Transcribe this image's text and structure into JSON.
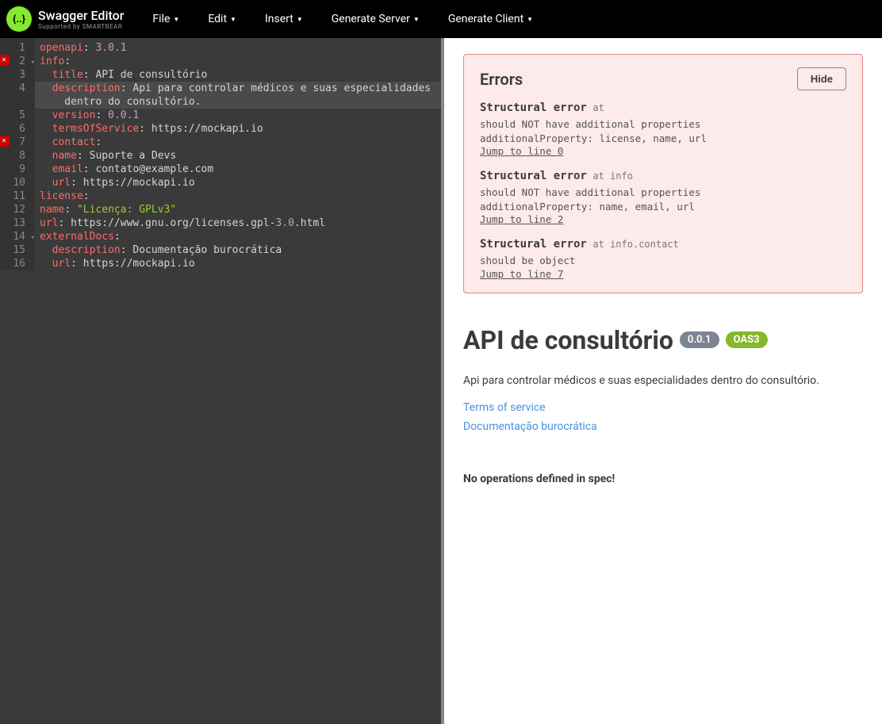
{
  "topbar": {
    "logo_main": "Swagger Editor",
    "logo_sub": "Supported by SMARTBEAR",
    "menu": [
      "File",
      "Edit",
      "Insert",
      "Generate Server",
      "Generate Client"
    ]
  },
  "editor": {
    "lines": [
      {
        "n": 1,
        "err": false,
        "fold": false,
        "hl": false,
        "tokens": [
          [
            "openapi",
            "key"
          ],
          [
            ": ",
            "punc"
          ],
          [
            "3.0.1",
            "num"
          ]
        ]
      },
      {
        "n": 2,
        "err": true,
        "fold": true,
        "hl": false,
        "tokens": [
          [
            "info",
            "key"
          ],
          [
            ":",
            "punc"
          ]
        ]
      },
      {
        "n": 3,
        "err": false,
        "fold": false,
        "hl": false,
        "tokens": [
          [
            "  ",
            ""
          ],
          [
            "title",
            "key"
          ],
          [
            ": ",
            "punc"
          ],
          [
            "API de consultório",
            "str"
          ]
        ]
      },
      {
        "n": 4,
        "err": false,
        "fold": false,
        "hl": true,
        "tokens": [
          [
            "  ",
            ""
          ],
          [
            "description",
            "key"
          ],
          [
            ": ",
            "punc"
          ],
          [
            "Api para controlar médicos e suas especialidades",
            "str"
          ]
        ]
      },
      {
        "n": "",
        "err": false,
        "fold": false,
        "hl": true,
        "tokens": [
          [
            "    dentro do consultório.",
            "str"
          ]
        ]
      },
      {
        "n": 5,
        "err": false,
        "fold": false,
        "hl": false,
        "tokens": [
          [
            "  ",
            ""
          ],
          [
            "version",
            "key"
          ],
          [
            ": ",
            "punc"
          ],
          [
            "0.0.1",
            "num"
          ]
        ]
      },
      {
        "n": 6,
        "err": false,
        "fold": false,
        "hl": false,
        "tokens": [
          [
            "  ",
            ""
          ],
          [
            "termsOfService",
            "key"
          ],
          [
            ": ",
            "punc"
          ],
          [
            "https://mockapi.io",
            "link"
          ]
        ]
      },
      {
        "n": 7,
        "err": true,
        "fold": false,
        "hl": false,
        "tokens": [
          [
            "  ",
            ""
          ],
          [
            "contact",
            "key"
          ],
          [
            ":",
            "punc"
          ]
        ]
      },
      {
        "n": 8,
        "err": false,
        "fold": false,
        "hl": false,
        "tokens": [
          [
            "  ",
            ""
          ],
          [
            "name",
            "key"
          ],
          [
            ": ",
            "punc"
          ],
          [
            "Suporte a Devs",
            "str"
          ]
        ]
      },
      {
        "n": 9,
        "err": false,
        "fold": false,
        "hl": false,
        "tokens": [
          [
            "  ",
            ""
          ],
          [
            "email",
            "key"
          ],
          [
            ": ",
            "punc"
          ],
          [
            "contato@example.com",
            "str"
          ]
        ]
      },
      {
        "n": 10,
        "err": false,
        "fold": false,
        "hl": false,
        "tokens": [
          [
            "  ",
            ""
          ],
          [
            "url",
            "key"
          ],
          [
            ": ",
            "punc"
          ],
          [
            "https://mockapi.io",
            "link"
          ]
        ]
      },
      {
        "n": 11,
        "err": false,
        "fold": false,
        "hl": false,
        "tokens": [
          [
            "license",
            "key"
          ],
          [
            ":",
            "punc"
          ]
        ]
      },
      {
        "n": 12,
        "err": false,
        "fold": false,
        "hl": false,
        "tokens": [
          [
            "name",
            "key"
          ],
          [
            ": ",
            "punc"
          ],
          [
            "\"Licença: GPLv3\"",
            "quoted"
          ]
        ]
      },
      {
        "n": 13,
        "err": false,
        "fold": false,
        "hl": false,
        "tokens": [
          [
            "url",
            "key"
          ],
          [
            ": ",
            "punc"
          ],
          [
            "https://www.gnu.org/licenses.gpl",
            "link"
          ],
          [
            "-",
            "punc"
          ],
          [
            "3.0",
            "num"
          ],
          [
            ".html",
            "link"
          ]
        ]
      },
      {
        "n": 14,
        "err": false,
        "fold": true,
        "hl": false,
        "tokens": [
          [
            "externalDocs",
            "key"
          ],
          [
            ":",
            "punc"
          ]
        ]
      },
      {
        "n": 15,
        "err": false,
        "fold": false,
        "hl": false,
        "tokens": [
          [
            "  ",
            ""
          ],
          [
            "description",
            "key"
          ],
          [
            ": ",
            "punc"
          ],
          [
            "Documentação burocrática",
            "str"
          ]
        ]
      },
      {
        "n": 16,
        "err": false,
        "fold": false,
        "hl": false,
        "tokens": [
          [
            "  ",
            ""
          ],
          [
            "url",
            "key"
          ],
          [
            ": ",
            "punc"
          ],
          [
            "https://mockapi.io",
            "link"
          ]
        ]
      }
    ]
  },
  "errors": {
    "title": "Errors",
    "hide": "Hide",
    "items": [
      {
        "label": "Structural error",
        "at": "at ",
        "lines": [
          "should NOT have additional properties",
          "additionalProperty: license, name, url"
        ],
        "jump": "Jump to line 0"
      },
      {
        "label": "Structural error",
        "at": "at info",
        "lines": [
          "should NOT have additional properties",
          "additionalProperty: name, email, url"
        ],
        "jump": "Jump to line 2"
      },
      {
        "label": "Structural error",
        "at": "at info.contact",
        "lines": [
          "should be object"
        ],
        "jump": "Jump to line 7"
      }
    ]
  },
  "api": {
    "title": "API de consultório",
    "version": "0.0.1",
    "oas": "OAS3",
    "description": "Api para controlar médicos e suas especialidades dentro do consultório.",
    "tos": "Terms of service",
    "ext_docs": "Documentação burocrática",
    "no_ops": "No operations defined in spec!"
  }
}
